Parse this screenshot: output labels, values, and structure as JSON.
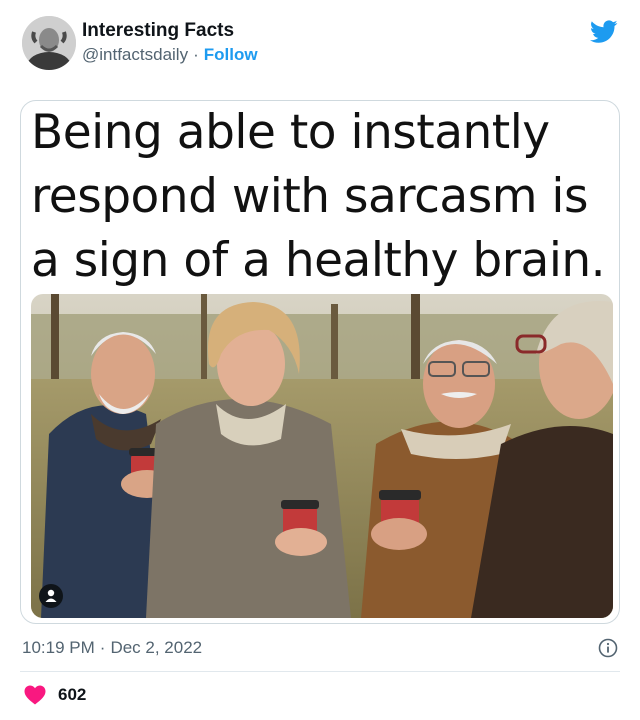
{
  "tweet": {
    "author_name": "Interesting Facts",
    "handle": "@intfactsdaily",
    "separator": "·",
    "follow_label": "Follow",
    "headline_lines": [
      "Being able to instantly",
      "respond with sarcasm is",
      "a sign of a healthy brain."
    ],
    "time": "10:19 PM",
    "date": "Dec 2, 2022",
    "like_count": "602"
  },
  "icons": {
    "brand": "twitter-bird-icon",
    "info": "info-icon",
    "like": "heart-icon",
    "alt": "person-icon"
  },
  "colors": {
    "accent": "#1d9bf0",
    "like": "#f91880",
    "muted_text": "#536471"
  }
}
